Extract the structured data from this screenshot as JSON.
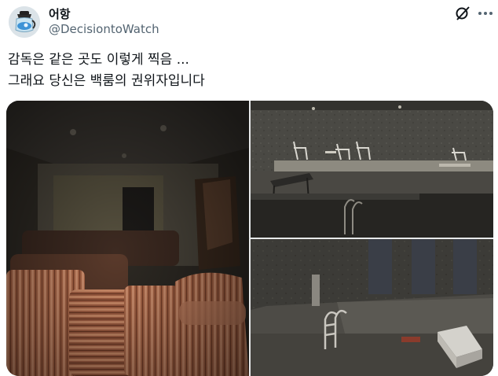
{
  "author": {
    "display_name": "어항",
    "handle": "@DecisiontoWatch"
  },
  "post": {
    "text_line_1": "감독은 같은 곳도 이렇게 찍음 ...",
    "text_line_2": "그래요 당신은 백룸의 권위자입니다"
  },
  "icons": {
    "avatar": "coffee-pot-avatar",
    "grok": "grok-icon",
    "more": "more-icon"
  },
  "media": {
    "count": 3,
    "photos": [
      "dark-room-with-striped-sofas",
      "indoor-pool-lounge-with-chairs",
      "empty-dark-pool-with-ladder"
    ]
  }
}
